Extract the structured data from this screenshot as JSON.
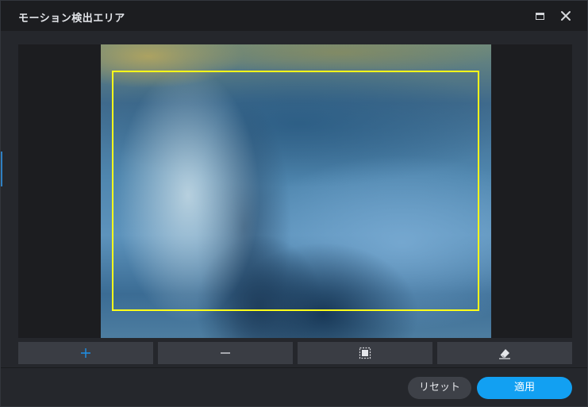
{
  "dialog": {
    "title": "モーション検出エリア"
  },
  "colors": {
    "accent": "#12a0f2",
    "area_outline": "#ffff1a",
    "add_icon": "#1e90e6"
  },
  "toolbar": {
    "add_icon": "plus-icon",
    "remove_icon": "minus-icon",
    "select_all_icon": "select-all-icon",
    "erase_icon": "eraser-icon"
  },
  "footer": {
    "reset_label": "リセット",
    "apply_label": "適用"
  }
}
